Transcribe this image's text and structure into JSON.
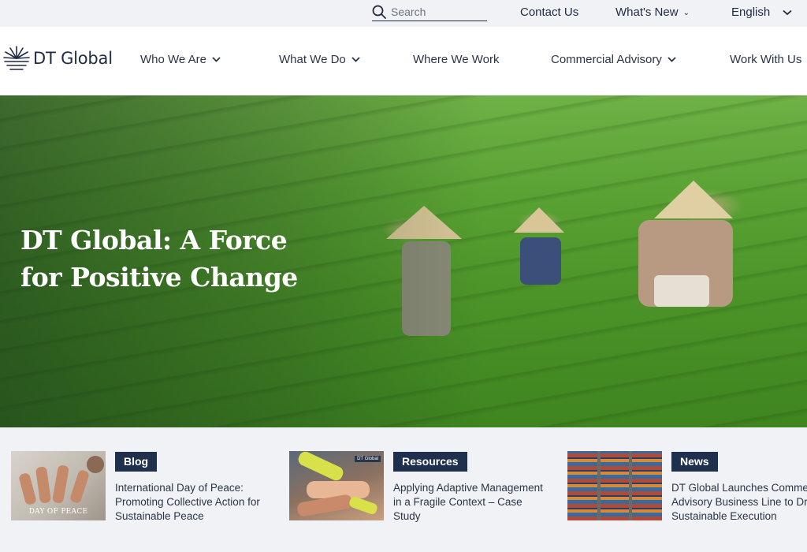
{
  "utility": {
    "search_placeholder": "Search",
    "contact": "Contact Us",
    "whats_new": "What's New",
    "language": "English"
  },
  "brand": {
    "name": "DT Global"
  },
  "nav": {
    "items": [
      {
        "label": "Who We Are",
        "dropdown": true
      },
      {
        "label": "What We Do",
        "dropdown": true
      },
      {
        "label": "Where We Work",
        "dropdown": false
      },
      {
        "label": "Commercial Advisory",
        "dropdown": true
      },
      {
        "label": "Work With Us",
        "dropdown": false
      }
    ]
  },
  "hero": {
    "title": "DT Global: A Force for Positive Change"
  },
  "cards": [
    {
      "category": "Blog",
      "title": "International Day of Peace: Promoting Collective Action for Sustainable Peace",
      "thumb_caption": "DAY OF PEACE"
    },
    {
      "category": "Resources",
      "title": "Applying Adaptive Management in a Fragile Context – Case Study",
      "thumb_tag": "DT Global"
    },
    {
      "category": "News",
      "title": "DT Global Launches Commercial Advisory Business Line to Drive Sustainable Execution"
    }
  ],
  "colors": {
    "navy": "#1f2f4e",
    "text": "#2a3547",
    "page_bg": "#f0f2f5"
  }
}
